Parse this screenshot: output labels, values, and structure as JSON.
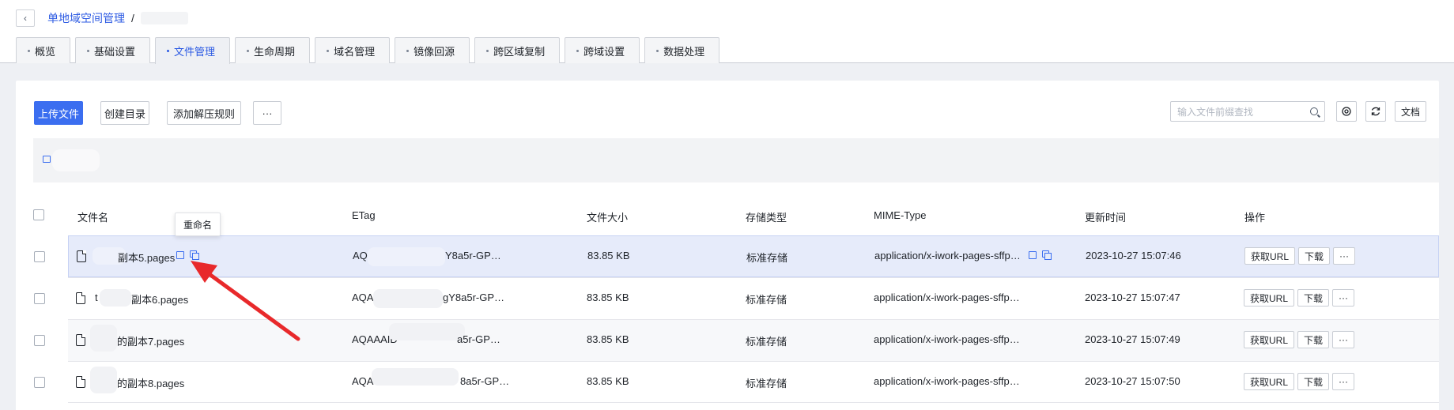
{
  "breadcrumb": {
    "root": "单地域空间管理",
    "sep": "/"
  },
  "tabs": [
    "概览",
    "基础设置",
    "文件管理",
    "生命周期",
    "域名管理",
    "镜像回源",
    "跨区域复制",
    "跨域设置",
    "数据处理"
  ],
  "active_tab": "文件管理",
  "toolbar": {
    "upload": "上传文件",
    "mkdir": "创建目录",
    "unzip_rule": "添加解压规则",
    "more": "···",
    "search_placeholder": "输入文件前缀查找",
    "docs": "文档"
  },
  "table": {
    "columns": [
      "文件名",
      "ETag",
      "文件大小",
      "存储类型",
      "MIME-Type",
      "更新时间",
      "操作"
    ],
    "rows": [
      {
        "name": "副本5.pages",
        "name_prefix": "",
        "etag_a": "AQ",
        "etag_b": "Y8a5r-GP…",
        "size": "83.85 KB",
        "storage": "标准存储",
        "mime": "application/x-iwork-pages-sffp…",
        "time": "2023-10-27 15:07:46"
      },
      {
        "name": "副本6.pages",
        "name_prefix": "t",
        "etag_a": "AQA",
        "etag_b": "gY8a5r-GP…",
        "size": "83.85 KB",
        "storage": "标准存储",
        "mime": "application/x-iwork-pages-sffp…",
        "time": "2023-10-27 15:07:47"
      },
      {
        "name": "的副本7.pages",
        "name_prefix": "",
        "etag_a": "AQAAAID",
        "etag_b": "a5r-GP…",
        "size": "83.85 KB",
        "storage": "标准存储",
        "mime": "application/x-iwork-pages-sffp…",
        "time": "2023-10-27 15:07:49"
      },
      {
        "name": "的副本8.pages",
        "name_prefix": "",
        "etag_a": "AQA",
        "etag_b": "8a5r-GP…",
        "size": "83.85 KB",
        "storage": "标准存储",
        "mime": "application/x-iwork-pages-sffp…",
        "time": "2023-10-27 15:07:50"
      }
    ],
    "actions": {
      "get_url": "获取URL",
      "download": "下载",
      "more": "···"
    }
  },
  "tooltip": "重命名",
  "colors": {
    "accent": "#3b6ef0",
    "link": "#2d5be3",
    "row_highlight": "#e6ebfa",
    "arrow": "#e8292b"
  }
}
